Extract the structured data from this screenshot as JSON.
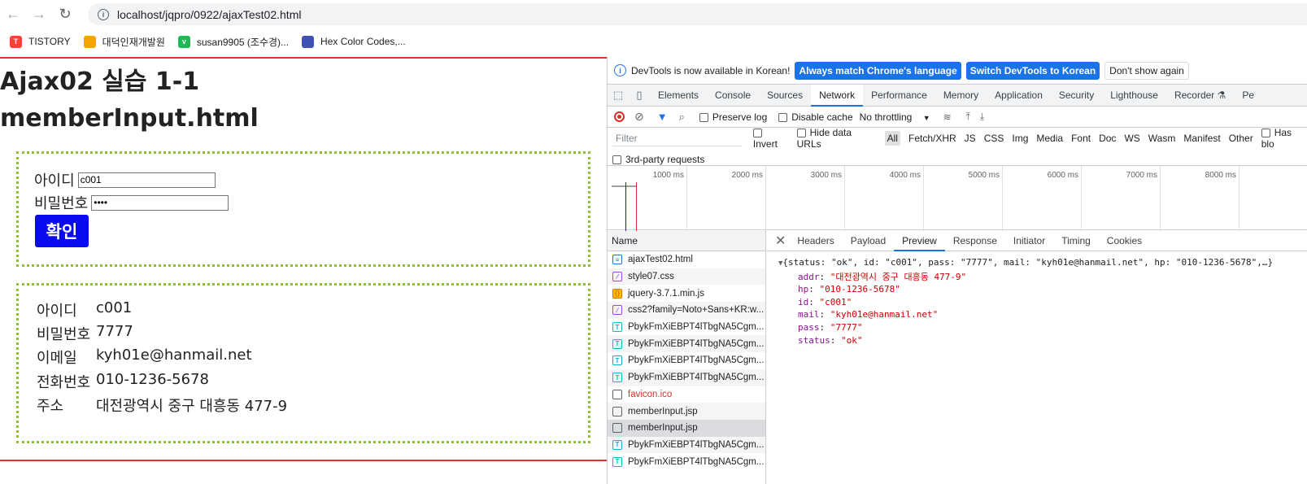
{
  "browser": {
    "url": "localhost/jqpro/0922/ajaxTest02.html",
    "bookmarks": [
      {
        "label": "TISTORY",
        "color": "#f44336",
        "glyph": "T"
      },
      {
        "label": "대덕인재개발원",
        "color": "#f4a300",
        "glyph": ""
      },
      {
        "label": "susan9905 (조수경)...",
        "color": "#1db954",
        "glyph": "v"
      },
      {
        "label": "Hex Color Codes,...",
        "color": "#3f51b5",
        "glyph": ""
      }
    ]
  },
  "page": {
    "title_line1": "Ajax02 실습 1-1",
    "title_line2": "memberInput.html",
    "form": {
      "id_label": "아이디",
      "id_value": "c001",
      "pass_label": "비밀번호",
      "pass_value": "••••",
      "submit_label": "확인"
    },
    "result": [
      {
        "key": "아이디",
        "value": "c001"
      },
      {
        "key": "비밀번호",
        "value": "7777"
      },
      {
        "key": "이메일",
        "value": "kyh01e@hanmail.net"
      },
      {
        "key": "전화번호",
        "value": "010-1236-5678"
      },
      {
        "key": "주소",
        "value": "대전광역시 중구 대흥동 477-9"
      }
    ]
  },
  "devtools": {
    "infobar": {
      "message": "DevTools is now available in Korean!",
      "btn_match": "Always match Chrome's language",
      "btn_switch": "Switch DevTools to Korean",
      "btn_dismiss": "Don't show again"
    },
    "tabs": [
      "Elements",
      "Console",
      "Sources",
      "Network",
      "Performance",
      "Memory",
      "Application",
      "Security",
      "Lighthouse",
      "Recorder ⚗",
      "Pe"
    ],
    "active_tab": "Network",
    "toolbar": {
      "preserve_log": "Preserve log",
      "disable_cache": "Disable cache",
      "throttling": "No throttling"
    },
    "filter": {
      "placeholder": "Filter",
      "invert": "Invert",
      "hide_data_urls": "Hide data URLs",
      "types": [
        "All",
        "Fetch/XHR",
        "JS",
        "CSS",
        "Img",
        "Media",
        "Font",
        "Doc",
        "WS",
        "Wasm",
        "Manifest",
        "Other"
      ],
      "has_blocked": "Has blo",
      "third_party": "3rd-party requests"
    },
    "timeline_ticks": [
      "1000 ms",
      "2000 ms",
      "3000 ms",
      "4000 ms",
      "5000 ms",
      "6000 ms",
      "7000 ms",
      "8000 ms"
    ],
    "name_header": "Name",
    "requests": [
      {
        "name": "ajaxTest02.html",
        "type": "doc"
      },
      {
        "name": "style07.css",
        "type": "css"
      },
      {
        "name": "jquery-3.7.1.min.js",
        "type": "js"
      },
      {
        "name": "css2?family=Noto+Sans+KR:w...",
        "type": "css"
      },
      {
        "name": "PbykFmXiEBPT4lTbgNA5Cgm...",
        "type": "font"
      },
      {
        "name": "PbykFmXiEBPT4lTbgNA5Cgm...",
        "type": "font"
      },
      {
        "name": "PbykFmXiEBPT4lTbgNA5Cgm...",
        "type": "font"
      },
      {
        "name": "PbykFmXiEBPT4lTbgNA5Cgm...",
        "type": "font"
      },
      {
        "name": "favicon.ico",
        "type": "error"
      },
      {
        "name": "memberInput.jsp",
        "type": "plain"
      },
      {
        "name": "memberInput.jsp",
        "type": "plain-selected"
      },
      {
        "name": "PbykFmXiEBPT4lTbgNA5Cgm...",
        "type": "font"
      },
      {
        "name": "PbykFmXiEBPT4lTbgNA5Cgm...",
        "type": "font"
      }
    ],
    "detail_tabs": [
      "Headers",
      "Payload",
      "Preview",
      "Response",
      "Initiator",
      "Timing",
      "Cookies"
    ],
    "active_detail_tab": "Preview",
    "preview": {
      "summary": "{status: \"ok\", id: \"c001\", pass: \"7777\", mail: \"kyh01e@hanmail.net\", hp: \"010-1236-5678\",…}",
      "fields": [
        {
          "key": "addr",
          "value": "\"대전광역시 중구 대흥동 477-9\""
        },
        {
          "key": "hp",
          "value": "\"010-1236-5678\""
        },
        {
          "key": "id",
          "value": "\"c001\""
        },
        {
          "key": "mail",
          "value": "\"kyh01e@hanmail.net\""
        },
        {
          "key": "pass",
          "value": "\"7777\""
        },
        {
          "key": "status",
          "value": "\"ok\""
        }
      ]
    }
  }
}
